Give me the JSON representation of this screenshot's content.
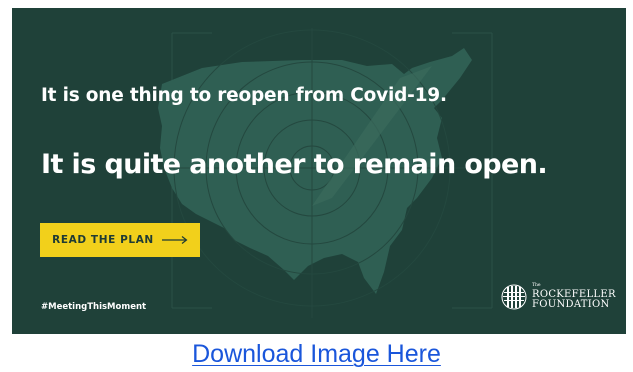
{
  "banner": {
    "headline_1": "It is one thing to reopen from Covid-19.",
    "headline_2": "It is quite another to remain open.",
    "cta_label": "READ THE PLAN",
    "hashtag": "#MeetingThisMoment",
    "logo": {
      "the": "The",
      "line_1": "ROCKEFELLER",
      "line_2": "FOUNDATION"
    },
    "background_color": "#1f4139",
    "map_color": "#2f5f53",
    "accent_color": "#f2d01b",
    "icons": [
      "arrow-right-icon",
      "globe-logo-icon",
      "usa-map-graphic",
      "target-rings-graphic"
    ]
  },
  "download": {
    "label": "Download Image Here"
  }
}
